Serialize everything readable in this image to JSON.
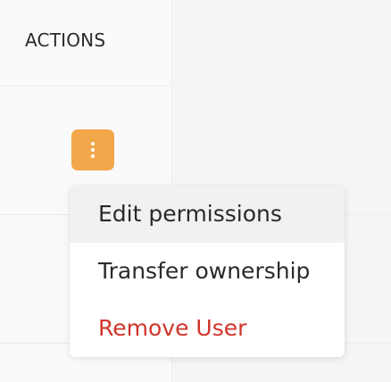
{
  "table": {
    "actions_header": "ACTIONS"
  },
  "row_actions": {
    "button_icon": "kebab-vertical-icon",
    "button_color": "#f2a74a"
  },
  "menu": {
    "items": [
      {
        "label": "Edit permissions",
        "highlighted": true
      },
      {
        "label": "Transfer ownership",
        "highlighted": false
      },
      {
        "label": "Remove User",
        "highlighted": false,
        "color": "#d0352b"
      }
    ]
  }
}
